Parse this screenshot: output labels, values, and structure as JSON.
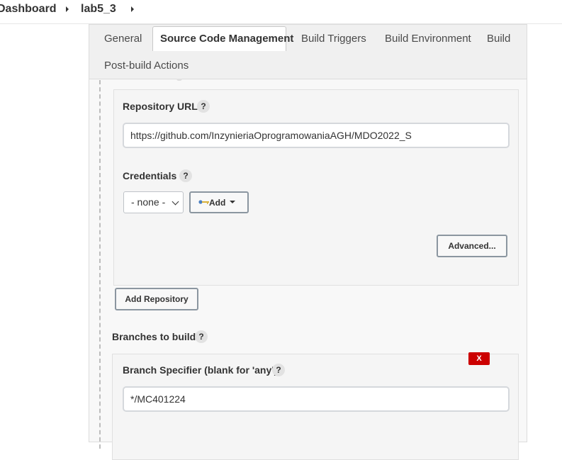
{
  "breadcrumb": {
    "items": [
      {
        "label": "Dashboard"
      },
      {
        "label": "lab5_3"
      }
    ]
  },
  "tabs": [
    {
      "label": "General",
      "active": false
    },
    {
      "label": "Source Code Management",
      "active": true
    },
    {
      "label": "Build Triggers",
      "active": false
    },
    {
      "label": "Build Environment",
      "active": false
    },
    {
      "label": "Build",
      "active": false
    },
    {
      "label": "Post-build Actions",
      "active": false
    }
  ],
  "repository": {
    "url_label": "Repository URL",
    "url_value": "https://github.com/InzynieriaOprogramowaniaAGH/MDO2022_S",
    "credentials_label": "Credentials",
    "credentials_selected": "- none -",
    "add_button": "Add",
    "advanced_button": "Advanced...",
    "help_glyph": "?"
  },
  "add_repository_button": "Add Repository",
  "branches": {
    "section_label": "Branches to build",
    "delete_glyph": "X",
    "specifier_label": "Branch Specifier (blank for 'any')",
    "specifier_value": "*/MC401224",
    "help_glyph": "?"
  },
  "colors": {
    "delete_button": "#cc0000",
    "panel_background": "#f8f8f8",
    "text": "#333333"
  }
}
